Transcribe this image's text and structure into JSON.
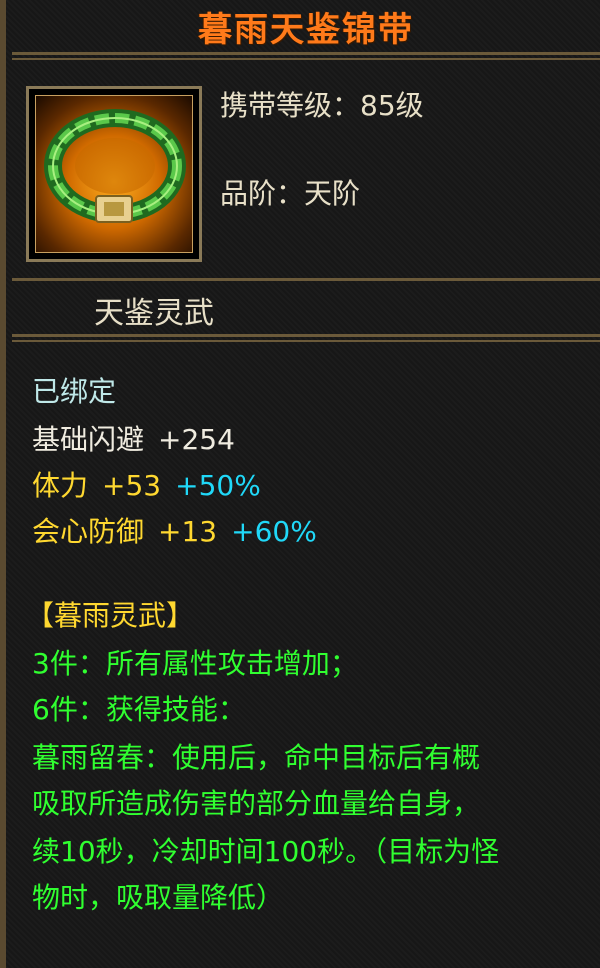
{
  "title": "暮雨天鉴锦带",
  "info": {
    "level": "携带等级：85级",
    "grade": "品阶：天阶"
  },
  "set_name": "天鉴灵武",
  "bound": "已绑定",
  "stats": [
    {
      "name": "基础闪避",
      "value": "+254",
      "bonus": ""
    },
    {
      "name": "体力",
      "value": "+53",
      "bonus": "+50%"
    },
    {
      "name": "会心防御",
      "value": "+13",
      "bonus": "+60%"
    }
  ],
  "set_bonus": {
    "header": "【暮雨灵武】",
    "lines": [
      "3件：所有属性攻击增加；",
      "6件：获得技能：",
      "暮雨留春：使用后，命中目标后有概",
      "吸取所造成伤害的部分血量给自身，",
      "续10秒，冷却时间100秒。（目标为怪",
      "物时，吸取量降低）"
    ]
  },
  "colors": {
    "title": "#ff7a1a",
    "base_stat": "#f0ece0",
    "yellow_stat": "#ffd830",
    "bonus": "#20d8f8",
    "set_text": "#30ff30",
    "border": "#6b5a3a"
  },
  "icon": "jade-belt-icon"
}
